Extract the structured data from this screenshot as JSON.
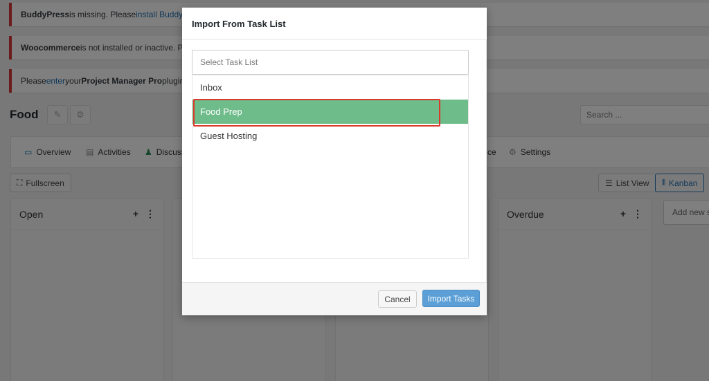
{
  "notices": [
    {
      "bold": "BuddyPress",
      "text": " is missing. Please ",
      "link": "install BuddyP"
    },
    {
      "bold": "Woocommerce",
      "text": " is not installed or inactive. Plea",
      "link": ""
    },
    {
      "prefix": "Please ",
      "link": "enter",
      "text": " your ",
      "bold": "Project Manager Pro",
      "suffix": " plugin"
    }
  ],
  "project": {
    "title": "Food"
  },
  "search": {
    "placeholder": "Search ..."
  },
  "menu": [
    {
      "label": "Overview",
      "icon": "monitor-icon"
    },
    {
      "label": "Activities",
      "icon": "activity-icon"
    },
    {
      "label": "Discuss",
      "icon": "discuss-icon"
    },
    {
      "label": "ce",
      "icon": ""
    },
    {
      "label": "Settings",
      "icon": "gear-icon"
    }
  ],
  "toolbar": {
    "fullscreen": "Fullscreen",
    "list_view": "List View",
    "kanban": "Kanban"
  },
  "columns": [
    {
      "title": "Open"
    },
    {
      "title": "Overdue"
    }
  ],
  "add_section": {
    "placeholder": "Add new se"
  },
  "modal": {
    "title": "Import From Task List",
    "select_placeholder": "Select Task List",
    "options": [
      {
        "label": "Inbox",
        "selected": false
      },
      {
        "label": "Food Prep",
        "selected": true
      },
      {
        "label": "Guest Hosting",
        "selected": false
      }
    ],
    "cancel": "Cancel",
    "import": "Import Tasks"
  },
  "colors": {
    "highlight": "#6ebc8a",
    "primary": "#5b9fd6",
    "error_border": "#d93a2b"
  }
}
